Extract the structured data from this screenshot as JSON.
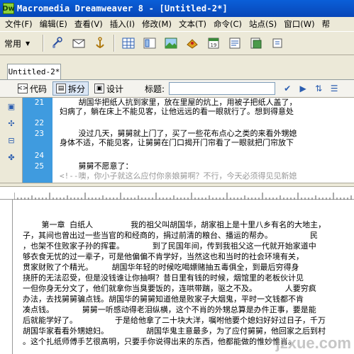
{
  "window": {
    "title": "Macromedia Dreamweaver 8 - [Untitled-2*]"
  },
  "menu": [
    "文件(F)",
    "编辑(E)",
    "查看(V)",
    "插入(I)",
    "修改(M)",
    "文本(T)",
    "命令(C)",
    "站点(S)",
    "窗口(W)",
    "帮"
  ],
  "toolbar": {
    "category": "常用",
    "icons": [
      "hyperlink-icon",
      "email-link-icon",
      "named-anchor-icon",
      "table-icon",
      "layer-icon",
      "image-icon",
      "media-icon",
      "date-icon",
      "comment-icon",
      "template-icon",
      "tag-chooser-icon"
    ]
  },
  "document": {
    "tab": "Untitled-2*"
  },
  "view": {
    "code_label": "代码",
    "split_label": "拆分",
    "design_label": "设计",
    "title_label": "标题:",
    "title_value": ""
  },
  "code": {
    "lines": [
      {
        "num": "21",
        "text": "    胡国华把纸人抗到家里，放在里屋的炕上，用被子把纸人盖了，"
      },
      {
        "num": "",
        "text": "妇病了，躺在床上不能见客，让他远远的看一眼就行了。想到得意处"
      },
      {
        "num": "22",
        "text": ""
      },
      {
        "num": "23",
        "text": "    没过几天，舅舅就上门了，买了一些花布点心之类的来看外甥媳"
      },
      {
        "num": "",
        "text": "身体不适，不能见客，让舅舅在门口揭开门帘看了一眼就把门帘放下"
      },
      {
        "num": "24",
        "text": ""
      },
      {
        "num": "25",
        "text": "    舅舅不愿意了："
      },
      {
        "num": "",
        "text": "<!--噢，你小子就这么应付你亲娘舅啊？不行，今天必须得见见新媳"
      }
    ]
  },
  "design": {
    "lines": [
      "    第一章 白纸人        我的祖父叫胡国华，胡家祖上是十里八乡有名的大地主，",
      "子，其间也曾出过一些当官的和经商的，捐过前清的粮台、播运的帮办。        民",
      "，也架不住败家子孙的挥霍。      到了民国年间，传到我祖父这一代就开始家道中",
      "够衣食无忧的过一辈子，可是他偏偏不肯学好，当然这也和当时的社会环境有关，",
      "贯家财败了个精光。    胡国华年轻的时候吃喝嫖赌抽五毒俱全，到最后穷得身",
      "挠肝的无法忍受，但是没钱谁让你抽啊？昔日里有钱的时候，烟馆里的老板伙计见",
      "一但你身无分文了，他们就拿你当臭要饭的，连哄带踹，驱之不及。      人要穷疯",
      "办法，去找舅舅骗点钱。胡国华的舅舅知道他是败家子大烟鬼，平时一文钱都不肯",
      "凑点钱。      舅舅一听感动得老泪纵横，这个不肖的外甥总算是办件正事，要是能",
      "后就能学好了。        于是给他拿了二十块大洋，嘱咐他要个媳妇好好过日子，千万",
      "胡国华家看看外甥媳妇。        胡国华鬼主意最多，为了应付舅舅，他回家之后到村",
      "。这个扎纸师傅手艺很高明，只要手你说得出来的东西，他都能做的惟妙惟肖。"
    ]
  },
  "watermark": "jzxue.com"
}
